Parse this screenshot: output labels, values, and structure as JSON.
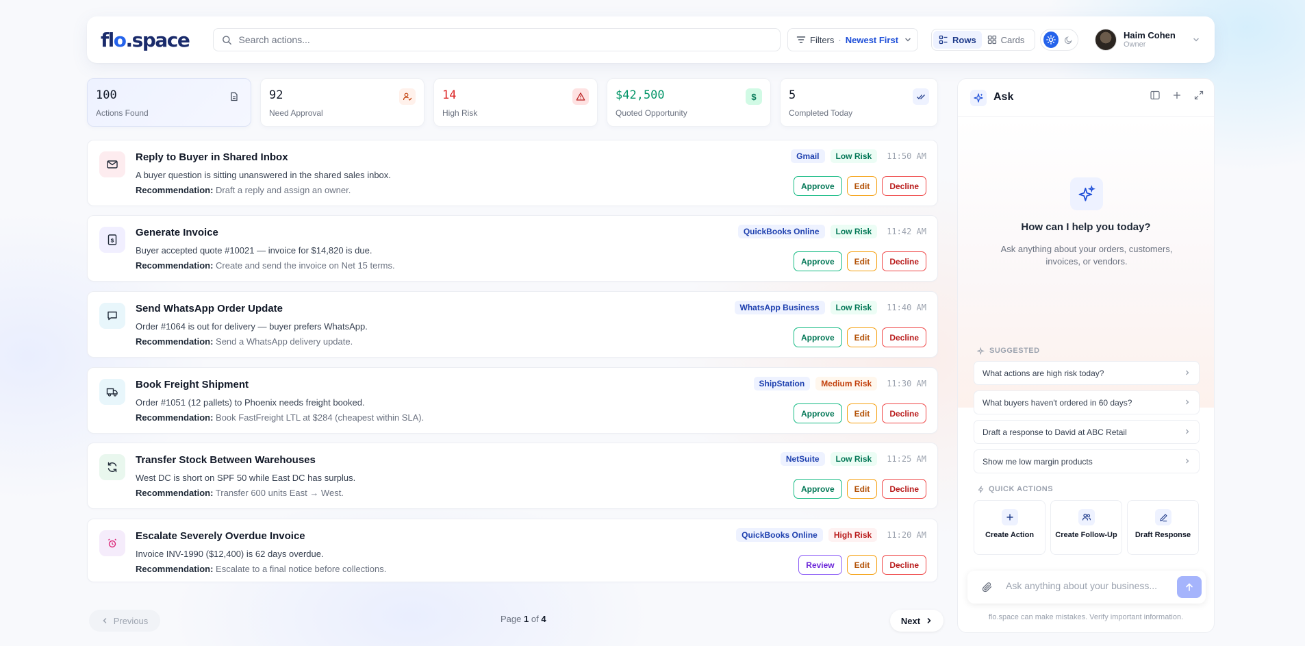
{
  "header": {
    "logo": "flo.space",
    "search_placeholder": "Search actions...",
    "filters_label": "Filters",
    "filters_dot": "·",
    "sort_value": "Newest First",
    "view_rows": "Rows",
    "view_cards": "Cards",
    "user_name": "Haim Cohen",
    "user_role": "Owner"
  },
  "stats": [
    {
      "value": "100",
      "label": "Actions Found",
      "icon": "document-icon",
      "color": "#111827"
    },
    {
      "value": "92",
      "label": "Need Approval",
      "icon": "user-check-icon",
      "color": "#111827"
    },
    {
      "value": "14",
      "label": "High Risk",
      "icon": "warning-icon",
      "color": "#dc2626"
    },
    {
      "value": "$42,500",
      "label": "Quoted Opportunity",
      "icon": "dollar-icon",
      "color": "#059669"
    },
    {
      "value": "5",
      "label": "Completed Today",
      "icon": "double-check-icon",
      "color": "#111827"
    }
  ],
  "actions": [
    {
      "title": "Reply to Buyer in Shared Inbox",
      "desc": "A buyer question is sitting unanswered in the shared sales inbox.",
      "rec_label": "Recommendation:",
      "rec": "Draft a reply and assign an owner.",
      "app": "Gmail",
      "risk": "Low Risk",
      "time": "11:50 AM",
      "icon": "mail-icon",
      "primary": "Approve",
      "edit": "Edit",
      "decline": "Decline"
    },
    {
      "title": "Generate Invoice",
      "desc": "Buyer accepted quote #10021 — invoice for $14,820 is due.",
      "rec_label": "Recommendation:",
      "rec": "Create and send the invoice on Net 15 terms.",
      "app": "QuickBooks Online",
      "risk": "Low Risk",
      "time": "11:42 AM",
      "icon": "invoice-icon",
      "primary": "Approve",
      "edit": "Edit",
      "decline": "Decline"
    },
    {
      "title": "Send WhatsApp Order Update",
      "desc": "Order #1064 is out for delivery — buyer prefers WhatsApp.",
      "rec_label": "Recommendation:",
      "rec": "Send a WhatsApp delivery update.",
      "app": "WhatsApp Business",
      "risk": "Low Risk",
      "time": "11:40 AM",
      "icon": "chat-icon",
      "primary": "Approve",
      "edit": "Edit",
      "decline": "Decline"
    },
    {
      "title": "Book Freight Shipment",
      "desc": "Order #1051 (12 pallets) to Phoenix needs freight booked.",
      "rec_label": "Recommendation:",
      "rec": "Book FastFreight LTL at $284 (cheapest within SLA).",
      "app": "ShipStation",
      "risk": "Medium Risk",
      "time": "11:30 AM",
      "icon": "truck-icon",
      "primary": "Approve",
      "edit": "Edit",
      "decline": "Decline"
    },
    {
      "title": "Transfer Stock Between Warehouses",
      "desc": "West DC is short on SPF 50 while East DC has surplus.",
      "rec_label": "Recommendation:",
      "rec": "Transfer 600 units East → West.",
      "app": "NetSuite",
      "risk": "Low Risk",
      "time": "11:25 AM",
      "icon": "refresh-icon",
      "primary": "Approve",
      "edit": "Edit",
      "decline": "Decline"
    },
    {
      "title": "Escalate Severely Overdue Invoice",
      "desc": "Invoice INV-1990 ($12,400) is 62 days overdue.",
      "rec_label": "Recommendation:",
      "rec": "Escalate to a final notice before collections.",
      "app": "QuickBooks Online",
      "risk": "High Risk",
      "time": "11:20 AM",
      "icon": "alarm-icon",
      "primary": "Review",
      "edit": "Edit",
      "decline": "Decline"
    }
  ],
  "pagination": {
    "prev": "Previous",
    "next": "Next",
    "page_word": "Page",
    "current": "1",
    "of_word": "of",
    "total": "4"
  },
  "ask": {
    "title": "Ask",
    "hero_title": "How can I help you today?",
    "hero_sub": "Ask anything about your orders, customers, invoices, or vendors.",
    "suggested_label": "SUGGESTED",
    "suggestions": [
      "What actions are high risk today?",
      "What buyers haven't ordered in 60 days?",
      "Draft a response to David at ABC Retail",
      "Show me low margin products"
    ],
    "quick_label": "QUICK ACTIONS",
    "quick_actions": [
      "Create Action",
      "Create Follow-Up",
      "Draft Response"
    ],
    "input_placeholder": "Ask anything about your business...",
    "disclaimer": "flo.space can make mistakes. Verify important information."
  }
}
